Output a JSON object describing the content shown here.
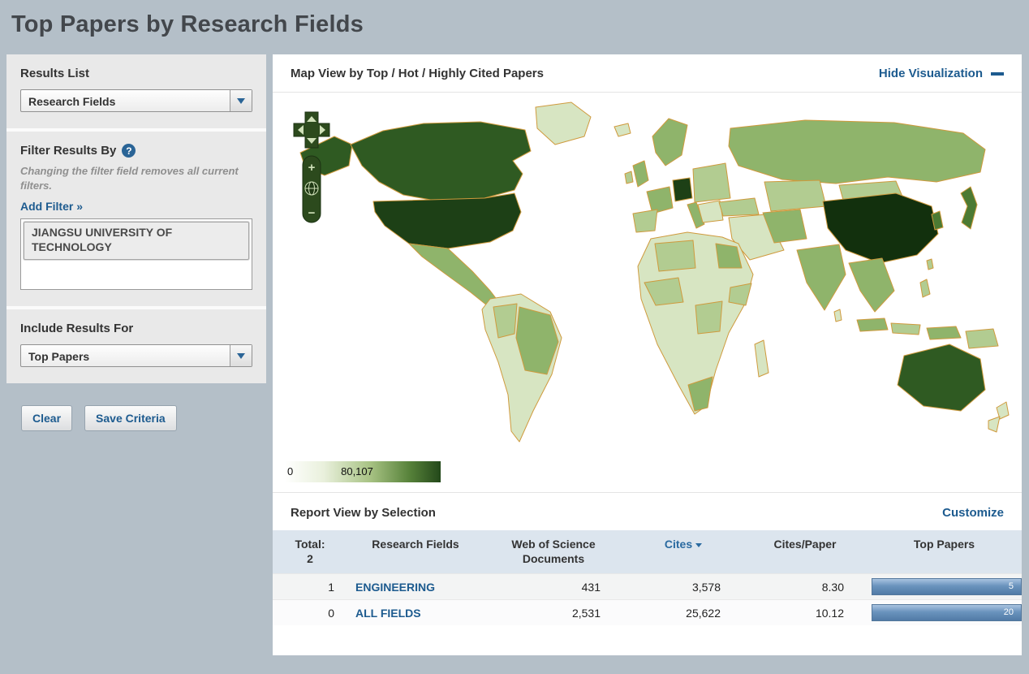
{
  "page": {
    "title": "Top Papers by Research Fields"
  },
  "sidebar": {
    "results_list": {
      "heading": "Results List",
      "selected": "Research Fields"
    },
    "filter": {
      "heading": "Filter Results By",
      "help_icon": "?",
      "note": "Changing the filter field removes all current filters.",
      "add_filter_link": "Add Filter »",
      "active_filter": "JIANGSU UNIVERSITY OF TECHNOLOGY"
    },
    "include_results": {
      "heading": "Include Results For",
      "selected": "Top Papers"
    },
    "actions": {
      "clear": "Clear",
      "save": "Save Criteria"
    }
  },
  "visualization": {
    "title": "Map View by Top / Hot / Highly Cited Papers",
    "hide_link": "Hide Visualization",
    "zoom": {
      "zoom_in": "+",
      "zoom_out": "−"
    },
    "legend": {
      "min": "0",
      "max": "80,107"
    }
  },
  "report": {
    "title": "Report View by Selection",
    "customize_link": "Customize",
    "table": {
      "headers": {
        "total_label": "Total:",
        "total_count": "2",
        "research_fields": "Research Fields",
        "wos_documents": "Web of Science Documents",
        "cites": "Cites",
        "cites_per_paper": "Cites/Paper",
        "top_papers": "Top Papers"
      },
      "rows": [
        {
          "rank": "1",
          "field": "ENGINEERING",
          "wos_documents": "431",
          "cites": "3,578",
          "cites_per_paper": "8.30",
          "top_papers": "5"
        },
        {
          "rank": "0",
          "field": "ALL FIELDS",
          "wos_documents": "2,531",
          "cites": "25,622",
          "cites_per_paper": "10.12",
          "top_papers": "20"
        }
      ]
    }
  },
  "colors": {
    "link_blue": "#1d5b8f",
    "table_header_bg": "#dce5ee",
    "map_border_orange": "#cf9a3d",
    "legend_max_green": "#23481a",
    "bar_blue": "#6a93bd"
  }
}
